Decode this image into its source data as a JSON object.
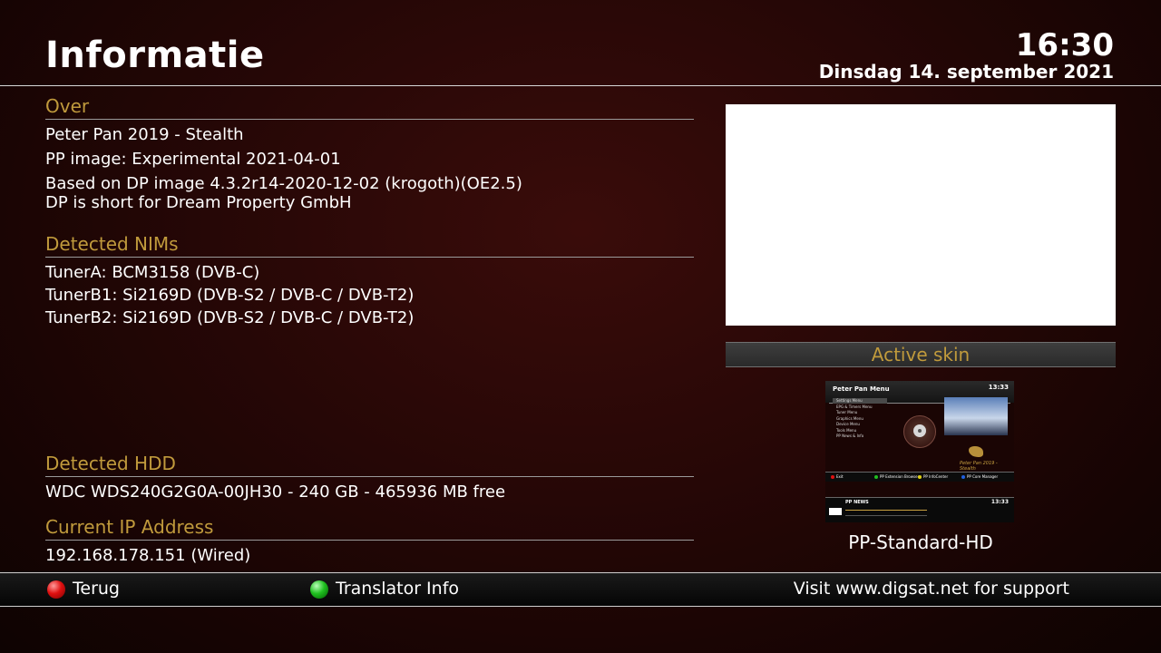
{
  "header": {
    "title": "Informatie",
    "time": "16:30",
    "date": "Dinsdag 14. september 2021"
  },
  "sections": {
    "about": {
      "heading": "Over",
      "lines": [
        "Peter Pan 2019 - Stealth",
        "PP image: Experimental 2021-04-01",
        "Based on DP image 4.3.2r14-2020-12-02 (krogoth)(OE2.5)",
        "DP is short for Dream Property GmbH"
      ]
    },
    "nims": {
      "heading": "Detected NIMs",
      "lines": [
        "TunerA: BCM3158 (DVB-C)",
        "TunerB1: Si2169D (DVB-S2 / DVB-C / DVB-T2)",
        "TunerB2: Si2169D (DVB-S2 / DVB-C / DVB-T2)"
      ]
    },
    "hdd": {
      "heading": "Detected HDD",
      "lines": [
        "WDC WDS240G2G0A-00JH30 - 240 GB - 465936 MB free"
      ]
    },
    "ip": {
      "heading": "Current IP Address",
      "lines": [
        "192.168.178.151 (Wired)"
      ]
    }
  },
  "skin": {
    "heading": "Active skin",
    "name": "PP-Standard-HD",
    "thumbnail": {
      "title": "Peter Pan Menu",
      "time": "13:33",
      "menu_items": [
        "Settings Menu",
        "EPG & Timers Menu",
        "Tuner Menu",
        "Graphics Menu",
        "Device Menu",
        "Tools Menu",
        "PP News & Info"
      ],
      "footer": [
        "Exit",
        "PP Extension Browser",
        "PP InfoCenter",
        "PP Core Manager"
      ],
      "news_title": "PP NEWS",
      "news_time": "13:33",
      "logo_text": "Peter Pan 2019 - Stealth"
    }
  },
  "footer": {
    "red_label": "Terug",
    "green_label": "Translator Info",
    "support_text": "Visit www.digsat.net for support"
  },
  "colors": {
    "accent": "#c09a3c",
    "red_button": "#e01010",
    "green_button": "#20c020"
  }
}
